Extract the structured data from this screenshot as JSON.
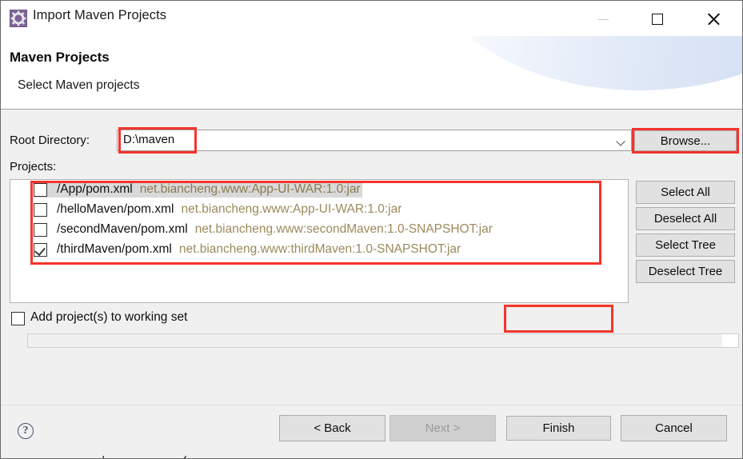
{
  "window": {
    "title": "Import Maven Projects",
    "icon": "maven-gear-icon",
    "controls": {
      "minimize": "minimize-icon",
      "maximize": "maximize-icon",
      "close": "close-icon"
    }
  },
  "header": {
    "title": "Maven Projects",
    "subtitle": "Select Maven projects"
  },
  "form": {
    "root_directory_label": "Root Directory:",
    "root_directory_value": "D:\\maven",
    "browse_label": "Browse...",
    "projects_label": "Projects:"
  },
  "projects": [
    {
      "path": "/App/pom.xml",
      "gav": "net.biancheng.www:App-UI-WAR:1.0:jar",
      "checked": false,
      "selected": true
    },
    {
      "path": "/helloMaven/pom.xml",
      "gav": "net.biancheng.www:App-UI-WAR:1.0:jar",
      "checked": false,
      "selected": false
    },
    {
      "path": "/secondMaven/pom.xml",
      "gav": "net.biancheng.www:secondMaven:1.0-SNAPSHOT:jar",
      "checked": false,
      "selected": false
    },
    {
      "path": "/thirdMaven/pom.xml",
      "gav": "net.biancheng.www:thirdMaven:1.0-SNAPSHOT:jar",
      "checked": true,
      "selected": false
    }
  ],
  "list_buttons": {
    "select_all": "Select All",
    "deselect_all": "Deselect All",
    "select_tree": "Select Tree",
    "deselect_tree": "Deselect Tree"
  },
  "working_set": {
    "checkbox_label": "Add project(s) to working set",
    "checked": false,
    "combo_value": "",
    "enabled": false
  },
  "footer": {
    "help": "?",
    "back": "< Back",
    "next": "Next >",
    "next_enabled": false,
    "finish": "Finish",
    "cancel": "Cancel"
  },
  "highlights": {
    "color": "#f5342b",
    "targets": [
      "root-directory-value",
      "browse-button",
      "projects-list",
      "finish-button"
    ]
  },
  "bottom_ghost_text": "Import Maven Projects"
}
